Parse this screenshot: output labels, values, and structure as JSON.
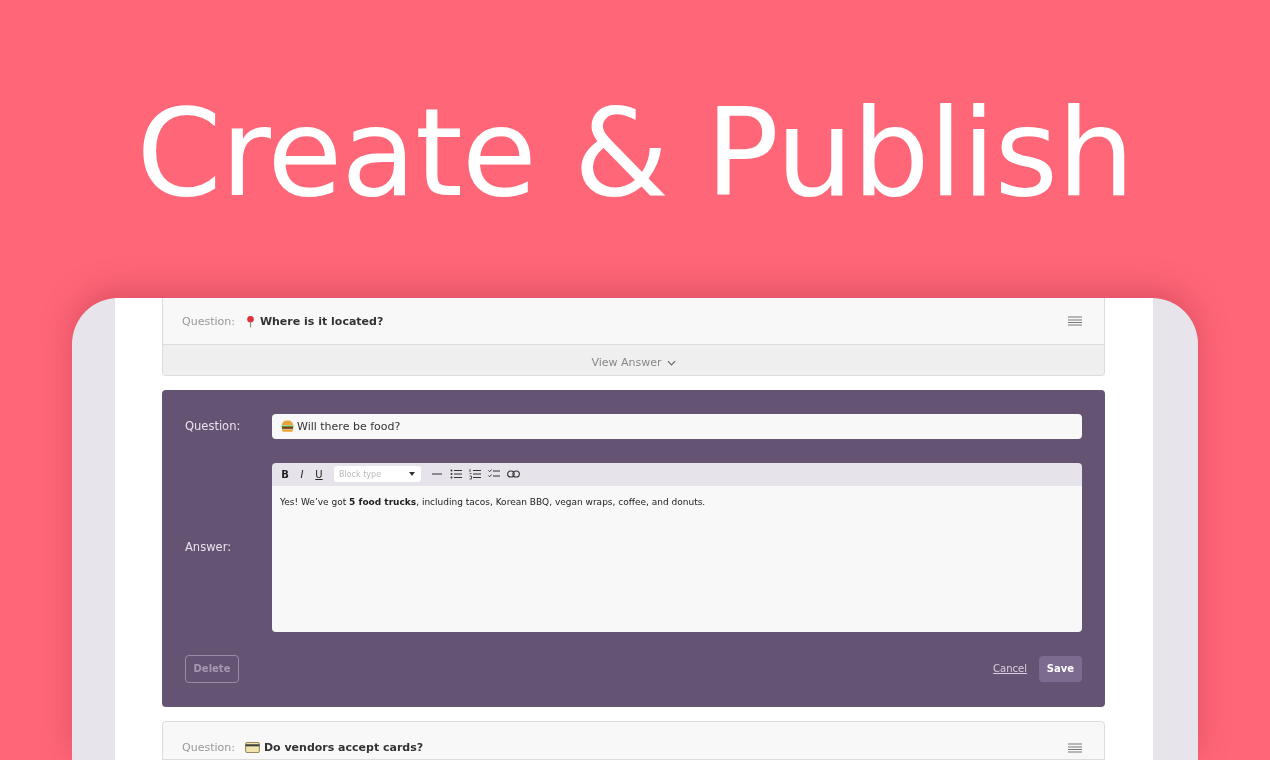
{
  "hero": {
    "title": "Create & Publish"
  },
  "faq_items": [
    {
      "kind": "collapsed",
      "question_label": "Question:",
      "question": "Where is it located?",
      "toggle": "View Answer"
    },
    {
      "kind": "editing",
      "question_label": "Question:",
      "question": "Will there be food?",
      "answer_label": "Answer:",
      "format_buttons": [
        "B",
        "I",
        "U"
      ],
      "block_type_placeholder": "Block type",
      "answer": "Yes! We’ve got **5 food trucks**, including tacos, Korean BBQ, vegan wraps, coffee, and donuts.",
      "delete": "Delete",
      "cancel": "Cancel",
      "save": "Save"
    },
    {
      "kind": "collapsed",
      "question_label": "Question:",
      "question": "Do vendors accept cards?"
    }
  ]
}
